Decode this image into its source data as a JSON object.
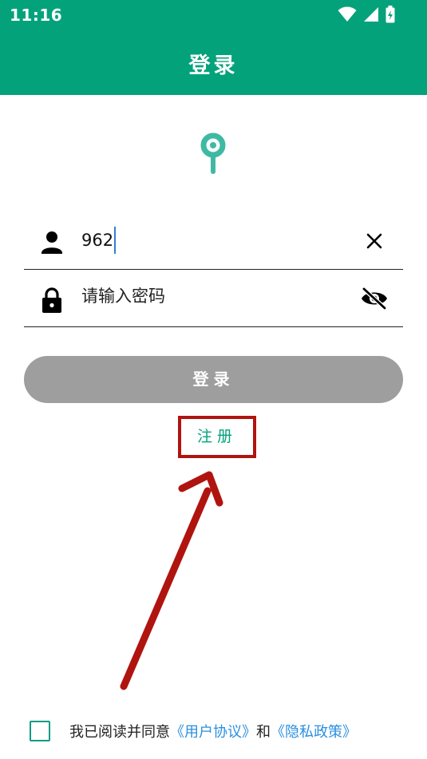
{
  "status_bar": {
    "time": "11:16"
  },
  "header": {
    "title": "登录"
  },
  "form": {
    "username_value": "962",
    "password_placeholder": "请输入密码",
    "login_button_label": "登录",
    "register_link_label": "注册"
  },
  "agreement": {
    "prefix": "我已阅读并同意",
    "user_agreement": "《用户协议》",
    "and": "和",
    "privacy_policy": "《隐私政策》"
  },
  "colors": {
    "brand": "#04a27b",
    "button_disabled": "#9e9e9e",
    "link": "#2a8fe0",
    "annotation": "#b0140f"
  },
  "icons": [
    "wifi-icon",
    "signal-icon",
    "battery-icon",
    "app-logo",
    "person-icon",
    "clear-icon",
    "lock-icon",
    "eye-off-icon"
  ]
}
